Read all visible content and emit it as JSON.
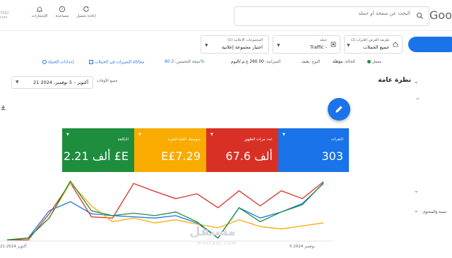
{
  "brand": "Goo",
  "search": {
    "placeholder": "البحث عن صفحة أو حملة"
  },
  "toolbar": {
    "refresh_label": "إعادة تحميل",
    "help_label": "مساعدة",
    "notifications_label": "الإشعارات"
  },
  "account": {
    "line1": "7562",
    "line2": "com"
  },
  "nav": {
    "item1": "نسبة والمحتوى"
  },
  "selectors": {
    "view": {
      "label": "طريقة العرض (فلترات:2)",
      "value": "جميع الحملات"
    },
    "campaign": {
      "label": "حملة",
      "value": "Traffic -"
    },
    "adgroups": {
      "label": "المجموعات الإعلانية (1)",
      "value": "اختيار مجموعة إعلانية"
    }
  },
  "status": {
    "status_label": "الحالة:",
    "status_value": "مؤهلة",
    "type_label": "النوع:",
    "type_value": "بحث",
    "budget_label": "الميزانية:",
    "budget_value": "260.00 ج.م./اليوم",
    "optimization_label": "نتيجة التحسين:",
    "optimization_value": "80.3%",
    "simulate_changes": "محاكاة التغييرات في الحملات",
    "campaign_settings": "إعدادات الحملة",
    "enabled": "مفعل"
  },
  "overview": {
    "title": "نظرة عامة",
    "all_time_label": "جميع الأوقات",
    "date_range": "21 أكتوبر – 5 نوفمبر، 2024"
  },
  "metrics": [
    {
      "label": "النقرات",
      "value": "303",
      "color": "#1a73e8"
    },
    {
      "label": "عدد مرات الظهور",
      "value": "67.6 ألف",
      "color": "#d93025"
    },
    {
      "label": "متوسط تكلفة النقرة",
      "value": "E£7.29",
      "color": "#f9ab00"
    },
    {
      "label": "التكلفة",
      "value": "2.21 ألف £E",
      "color": "#1e8e3e"
    }
  ],
  "chart_data": {
    "type": "line",
    "x": [
      "21 أكتوبر 2024",
      "5 نوفمبر 2024"
    ],
    "x_labels": [
      "21 أكتوبر 2024",
      "5 نوفمبر 2024"
    ],
    "series": [
      {
        "name": "النقرات",
        "color": "#1a73e8",
        "values": [
          0.02,
          0.05,
          0.5,
          0.65,
          0.45,
          0.42,
          0.4,
          0.38,
          0.42,
          0.3,
          0.05,
          0.55,
          0.38,
          0.48,
          0.62,
          0.95
        ]
      },
      {
        "name": "عدد مرات الظهور",
        "color": "#d93025",
        "values": [
          0.02,
          0.02,
          0.45,
          0.96,
          0.4,
          0.38,
          0.95,
          0.82,
          0.7,
          0.78,
          0.55,
          0.83,
          0.58,
          0.83,
          0.7,
          0.98
        ]
      },
      {
        "name": "متوسط تكلفة النقرة",
        "color": "#f9ab00",
        "values": [
          0.02,
          0.05,
          0.38,
          0.96,
          0.58,
          0.32,
          0.38,
          0.3,
          0.35,
          0.28,
          0.22,
          0.35,
          0.24,
          0.2,
          0.25,
          0.3
        ]
      },
      {
        "name": "التكلفة",
        "color": "#1e8e3e",
        "values": [
          0.02,
          0.05,
          0.38,
          0.99,
          0.5,
          0.42,
          0.46,
          0.42,
          0.48,
          0.32,
          0.05,
          0.55,
          0.32,
          0.48,
          0.6,
          0.96
        ]
      }
    ]
  },
  "watermark": {
    "ar": "مستقل",
    "en": "mostaql.com"
  }
}
